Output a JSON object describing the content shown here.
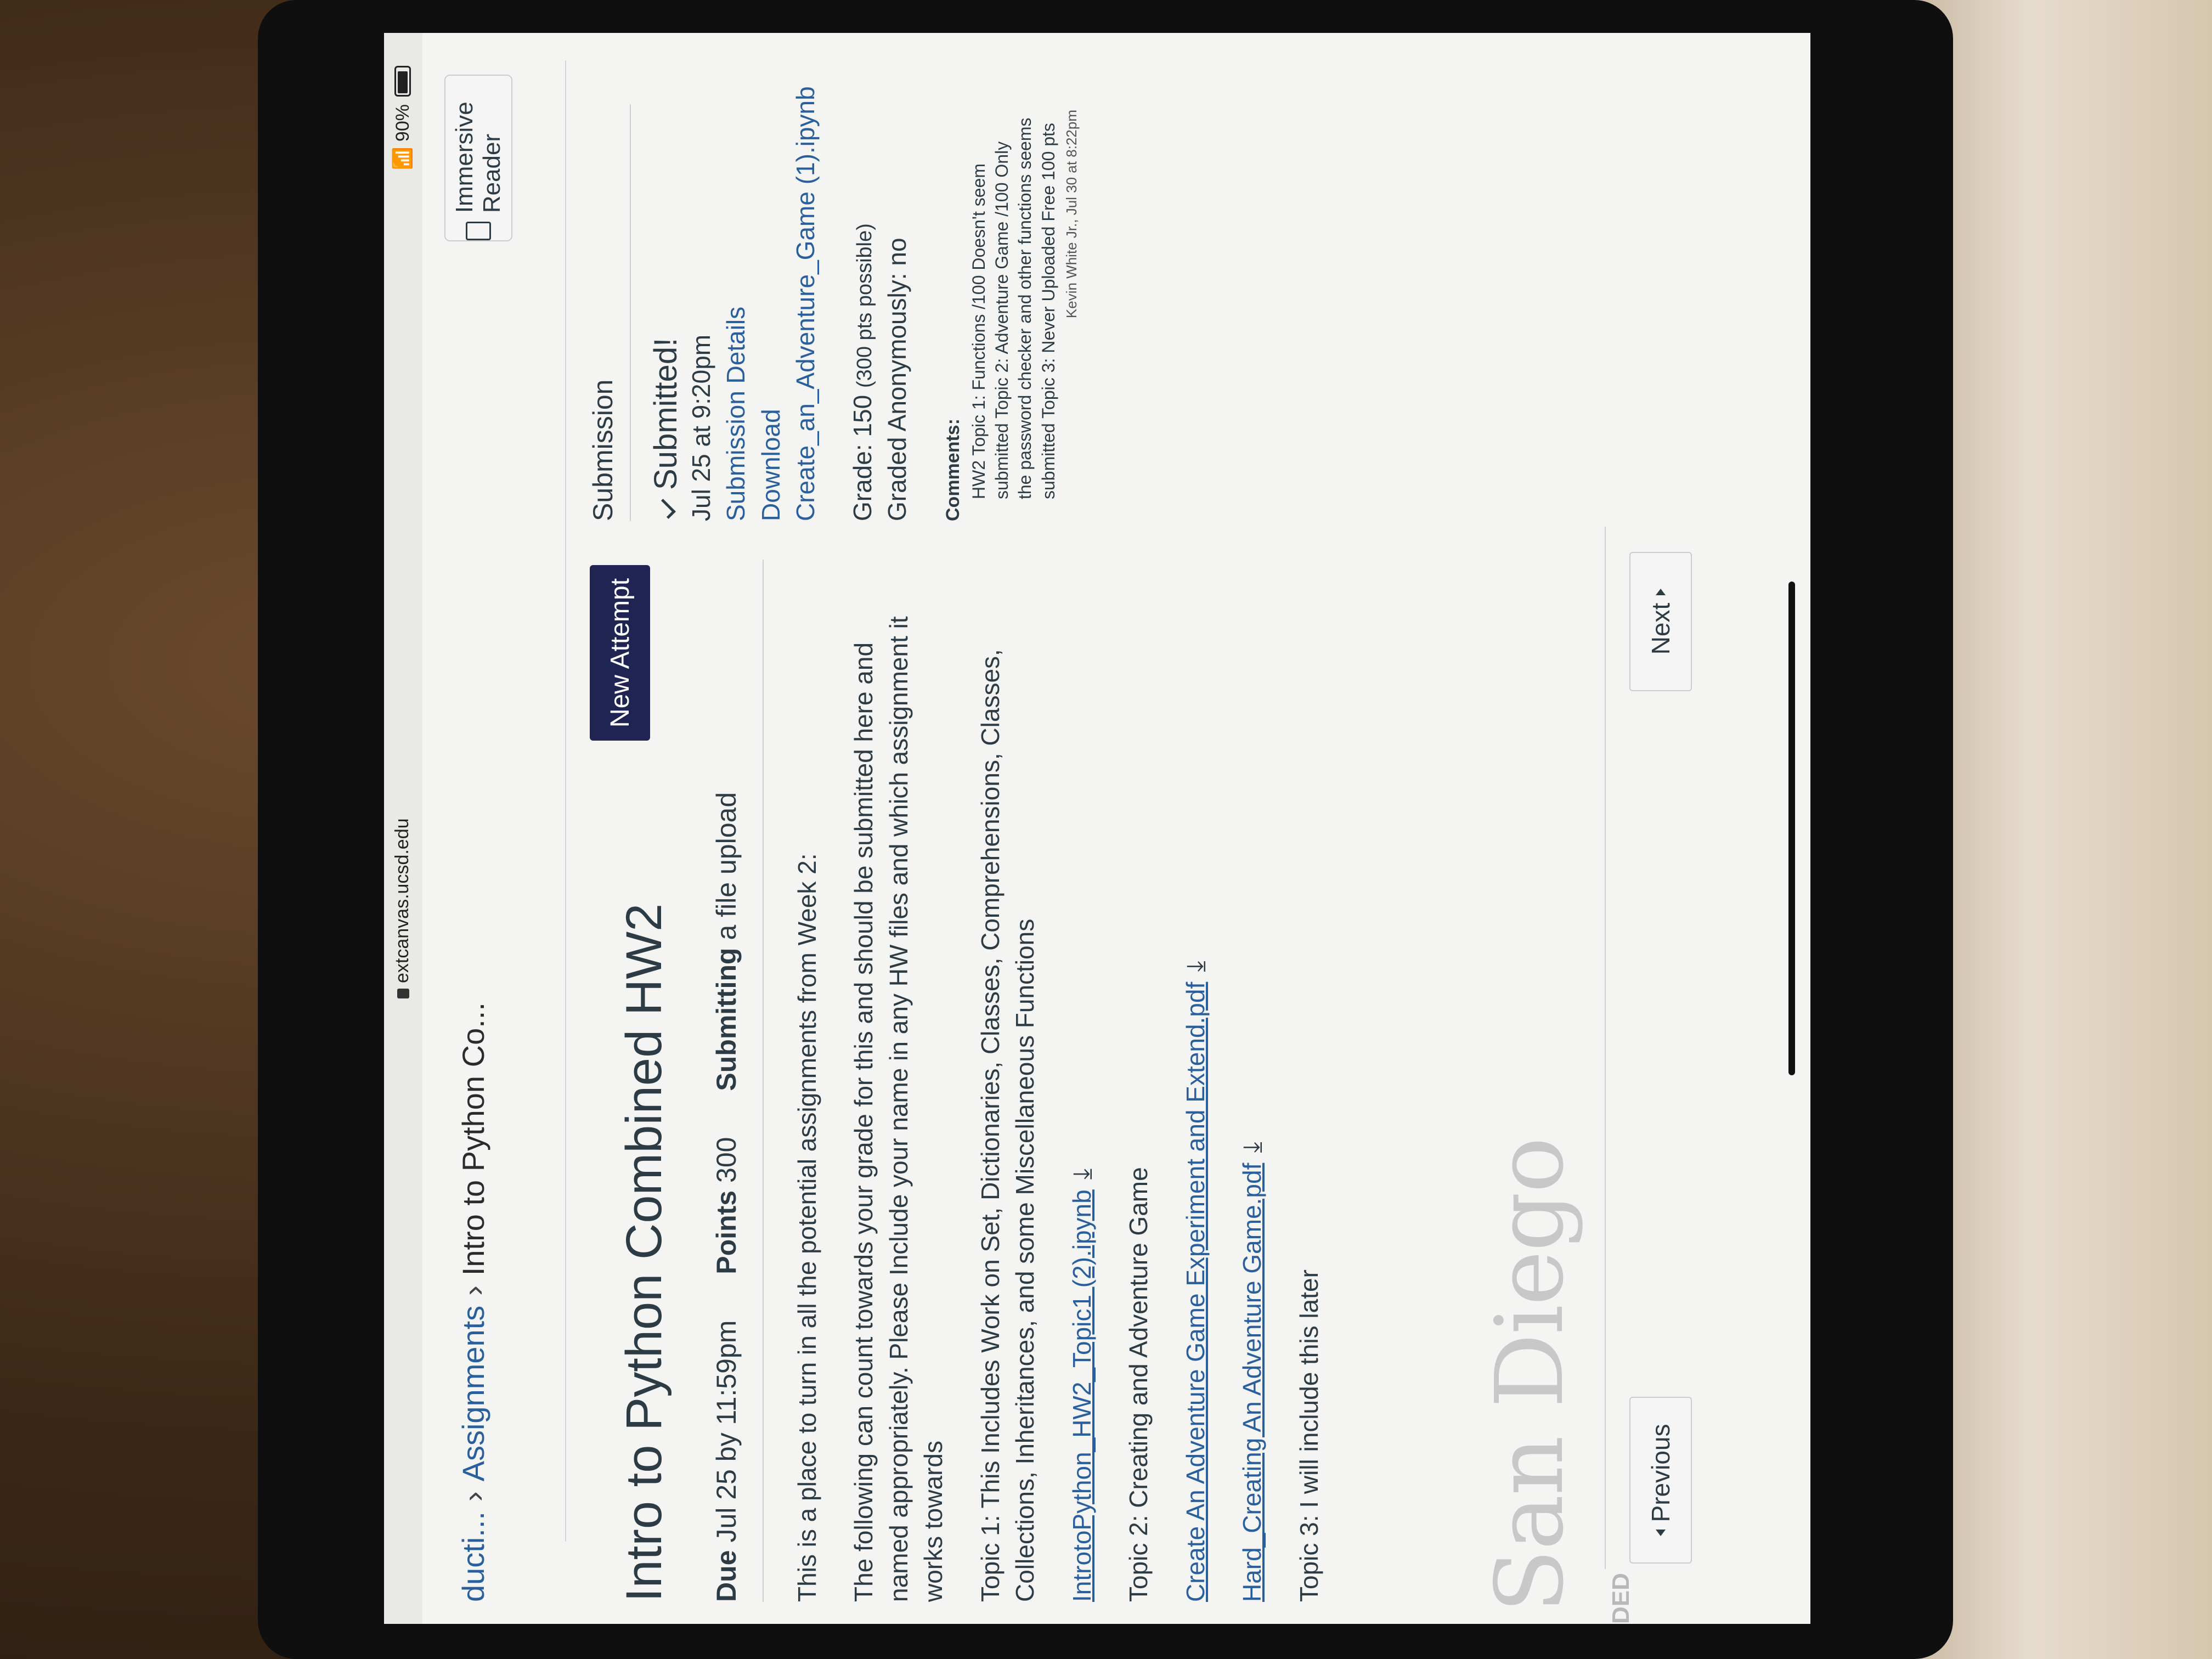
{
  "browser": {
    "url": "extcanvas.ucsd.edu",
    "battery": "90%"
  },
  "breadcrumb": {
    "first": "ducti...",
    "second": "Assignments",
    "third": "Intro to Python Co..."
  },
  "toolbar": {
    "immersive_reader": "Immersive Reader"
  },
  "assignment": {
    "title": "Intro to Python Combined HW2",
    "new_attempt": "New Attempt",
    "due_label": "Due",
    "due_value": "Jul 25 by 11:59pm",
    "points_label": "Points",
    "points_value": "300",
    "submitting_label": "Submitting",
    "submitting_value": "a file upload"
  },
  "description": {
    "p1": "This is a place to turn in all the potential assignments from Week 2:",
    "p2": "The following can count towards your grade for this and should be submitted here and named appropriately. Please Include your name in any HW files and which assignment it works towards",
    "p3": "Topic 1: This Includes Work on Set, Dictionaries, Classes, Comprehensions, Classes, Collections, Inheritances, and some Miscellaneous Functions",
    "link1": "IntrotoPython_HW2_Topic1 (2).ipynb",
    "p4": "Topic 2: Creating and Adventure Game",
    "link2": "Create An Adventure Game Experiment and Extend.pdf",
    "link3": "Hard_Creating An Adventure Game.pdf",
    "p5": "Topic 3: I will include this later"
  },
  "watermark": {
    "text": "San Diego",
    "ded": "DED"
  },
  "nav": {
    "previous": "Previous",
    "next": "Next"
  },
  "submission": {
    "heading": "Submission",
    "status": "Submitted!",
    "date": "Jul 25 at 9:20pm",
    "details_link": "Submission Details",
    "download_label": "Download",
    "file_link": "Create_an_Adventure_Game (1).ipynb",
    "grade": "Grade: 150",
    "grade_possible": "(300 pts possible)",
    "anonymous": "Graded Anonymously: no",
    "comments_heading": "Comments:",
    "comment_text": "HW2 Topic 1: Functions /100 Doesn't seem submitted Topic 2: Adventure Game /100 Only the password checker and other functions seems submitted Topic 3: Never Uploaded Free 100 pts",
    "comment_meta": "Kevin White Jr., Jul 30 at 8:22pm"
  }
}
